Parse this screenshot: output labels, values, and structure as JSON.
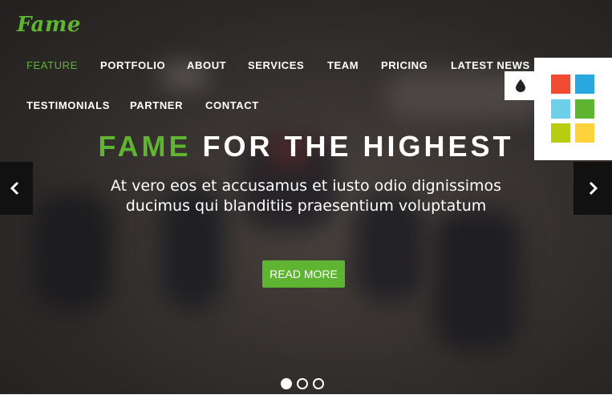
{
  "brand": {
    "logo": "Fame",
    "accent_color": "#5fb432"
  },
  "nav": {
    "items": [
      {
        "label": "FEATURE",
        "active": true
      },
      {
        "label": "PORTFOLIO"
      },
      {
        "label": "ABOUT"
      },
      {
        "label": "SERVICES"
      },
      {
        "label": "TEAM"
      },
      {
        "label": "PRICING"
      },
      {
        "label": "LATEST NEWS"
      },
      {
        "label": "TESTIMONIALS"
      },
      {
        "label": "PARTNER"
      },
      {
        "label": "CONTACT"
      }
    ]
  },
  "hero": {
    "title_accent": "FAME",
    "title_rest": "FOR THE HIGHEST",
    "subtitle_line1": "At vero eos et accusamus et iusto odio dignissimos",
    "subtitle_line2": "ducimus qui blanditiis praesentium voluptatum",
    "button_label": "READ MORE",
    "prev_icon": "chevron-left-icon",
    "next_icon": "chevron-right-icon",
    "slides": {
      "count": 3,
      "active_index": 0
    }
  },
  "style_switcher": {
    "toggle_icon": "droplet-icon",
    "swatches": [
      "#f04a30",
      "#29a8e0",
      "#6dd0e8",
      "#5fb432",
      "#b8cd10",
      "#fdd23b"
    ]
  }
}
